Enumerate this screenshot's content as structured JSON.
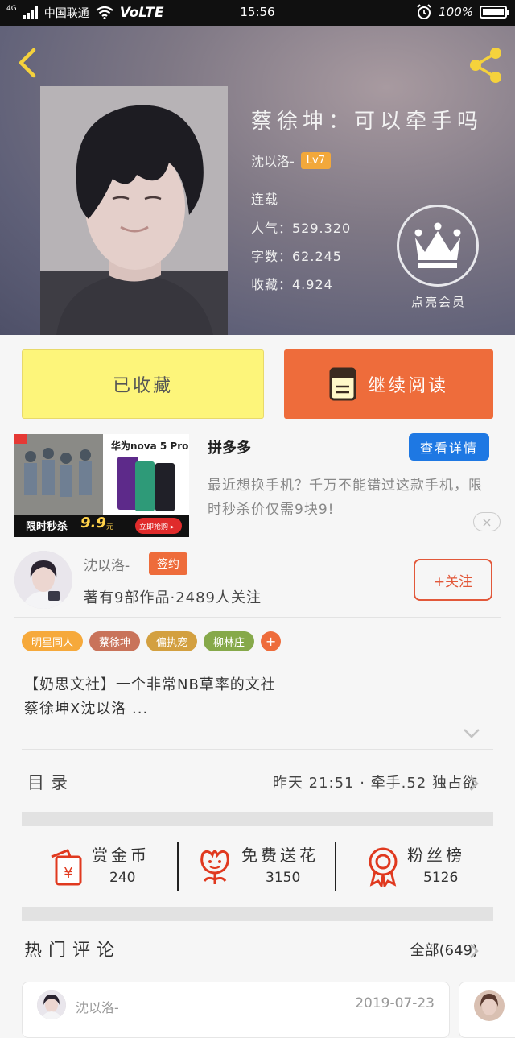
{
  "status_bar": {
    "carrier": "中国联通",
    "network": "4G",
    "volte": "VoLTE",
    "time": "15:56",
    "battery": "100%",
    "battery_level": 1.0
  },
  "book": {
    "title": "蔡徐坤：可以牵手吗",
    "author": "沈以洛-",
    "level": "Lv7",
    "status": "连载",
    "popularity": "人气：529.320",
    "word_count": "字数：62.245",
    "favorites": "收藏：4.924",
    "vip_label": "点亮会员"
  },
  "actions": {
    "collected": "已收藏",
    "continue_reading": "继续阅读"
  },
  "ad": {
    "brand": "拼多多",
    "detail_button": "查看详情",
    "description": "最近想换手机？千万不能错过这款手机，限时秒杀价仅需9块9!",
    "image_phone_title": "华为nova 5 Pro",
    "image_sale_text": "限时秒杀",
    "image_price": "9.9",
    "image_price_unit": "元",
    "image_buy_button": "立即抢购 ▸",
    "close_symbol": "×"
  },
  "author": {
    "name": "沈以洛-",
    "badge": "签约",
    "stats": "著有9部作品·2489人关注",
    "follow_button": "+关注"
  },
  "tags": [
    {
      "label": "明星同人",
      "color": "#f6a93b"
    },
    {
      "label": "蔡徐坤",
      "color": "#c9735a"
    },
    {
      "label": "偏执宠",
      "color": "#d3a040"
    },
    {
      "label": "柳林庄",
      "color": "#86a94a"
    }
  ],
  "tags_more": "+",
  "description": {
    "line1": "【奶思文社】一个非常NB草率的文社",
    "line2": "蔡徐坤X沈以洛 ..."
  },
  "toc": {
    "label": "目录",
    "latest": "昨天 21:51 · 牵手.52 独占欲"
  },
  "stats": [
    {
      "label": "赏金币",
      "value": "240",
      "icon": "red-envelope-icon"
    },
    {
      "label": "免费送花",
      "value": "3150",
      "icon": "flower-icon"
    },
    {
      "label": "粉丝榜",
      "value": "5126",
      "icon": "medal-icon"
    }
  ],
  "comments": {
    "title": "热门评论",
    "all": "全部(649)",
    "first": {
      "name": "沈以洛-",
      "date": "2019-07-23"
    }
  },
  "colors": {
    "accent_orange": "#ee6c3b",
    "collected_yellow": "#fdf57a",
    "ad_blue": "#1e78e3"
  }
}
